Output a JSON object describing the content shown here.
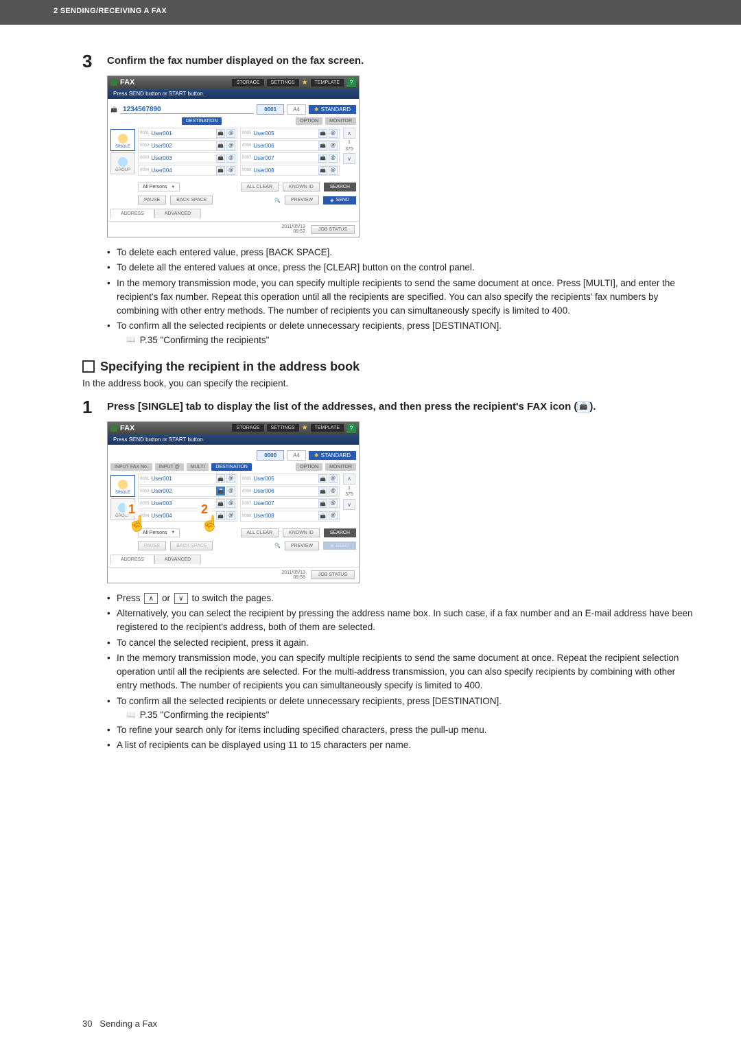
{
  "header": {
    "chapter": "2 SENDING/RECEIVING A FAX"
  },
  "step3": {
    "num": "3",
    "title": "Confirm the fax number displayed on the fax screen."
  },
  "panel1": {
    "title": "FAX",
    "hdr": {
      "storage": "STORAGE",
      "settings": "SETTINGS",
      "template": "TEMPLATE",
      "help": "?"
    },
    "msg": "Press SEND button or START button.",
    "faxno": "1234567890",
    "count": "0001",
    "paper": "A4",
    "std": "STANDARD",
    "tabs": {
      "dest": "DESTINATION",
      "option": "OPTION",
      "monitor": "MONITOR"
    },
    "side": {
      "single": "SINGLE",
      "group": "GROUP"
    },
    "rows": [
      {
        "l": {
          "idx": "0001",
          "name": "User001"
        },
        "r": {
          "idx": "0005",
          "name": "User005"
        }
      },
      {
        "l": {
          "idx": "0002",
          "name": "User002"
        },
        "r": {
          "idx": "0006",
          "name": "User006"
        }
      },
      {
        "l": {
          "idx": "0003",
          "name": "User003"
        },
        "r": {
          "idx": "0007",
          "name": "User007"
        }
      },
      {
        "l": {
          "idx": "0004",
          "name": "User004"
        },
        "r": {
          "idx": "0008",
          "name": "User008"
        }
      }
    ],
    "page": {
      "cur": "1",
      "total": "375"
    },
    "filter": "All Persons",
    "meta": {
      "allclear": "ALL CLEAR",
      "knownid": "KNOWN ID",
      "search": "SEARCH"
    },
    "act": {
      "pause": "PAUSE",
      "back": "BACK SPACE",
      "preview": "PREVIEW",
      "send": "SEND"
    },
    "bottabs": {
      "addr": "ADDRESS",
      "adv": "ADVANCED"
    },
    "status": {
      "time": "2011/05/13\n08:52",
      "job": "JOB STATUS"
    }
  },
  "bullets3": [
    "To delete each entered value, press [BACK SPACE].",
    "To delete all the entered values at once, press the [CLEAR] button on the control panel.",
    "In the memory transmission mode, you can specify multiple recipients to send the same document at once. Press [MULTI], and enter the recipient's fax number. Repeat this operation until all the recipients are specified. You can also specify the recipients' fax numbers by combining with other entry methods. The number of recipients you can simultaneously specify is limited to 400.",
    "To confirm all the selected recipients or delete unnecessary recipients, press [DESTINATION]."
  ],
  "ref3": "P.35 \"Confirming the recipients\"",
  "section2_title": "Specifying the recipient in the address book",
  "section2_intro": "In the address book, you can specify the recipient.",
  "step1": {
    "num": "1",
    "title_a": "Press [SINGLE] tab to display the list of the addresses, and then press the recipient's FAX icon (",
    "title_b": ")."
  },
  "panel2": {
    "count": "0000",
    "tabs": {
      "inputfax": "INPUT FAX No.",
      "inputat": "INPUT @",
      "multi": "MULTI",
      "dest": "DESTINATION",
      "option": "OPTION",
      "monitor": "MONITOR"
    },
    "status_time": "2011/05/13\n08:58"
  },
  "callouts": {
    "one": "1",
    "two": "2"
  },
  "bullets1": {
    "b0a": "Press ",
    "b0b": " or ",
    "b0c": " to switch the pages.",
    "b1": "Alternatively, you can select the recipient by pressing the address name box. In such case, if a fax number and an E-mail address have been registered to the recipient's address, both of them are selected.",
    "b2": "To cancel the selected recipient, press it again.",
    "b3": "In the memory transmission mode, you can specify multiple recipients to send the same document at once. Repeat the recipient selection operation until all the recipients are selected. For the multi-address transmission, you can also specify recipients by combining with other entry methods. The number of recipients you can simultaneously specify is limited to 400.",
    "b4": "To confirm all the selected recipients or delete unnecessary recipients, press [DESTINATION].",
    "b5": "To refine your search only for items including specified characters, press the pull-up menu.",
    "b6": "A list of recipients can be displayed using 11 to 15 characters per name."
  },
  "ref1": "P.35 \"Confirming the recipients\"",
  "footer": {
    "pagenum": "30",
    "section": "Sending a Fax"
  }
}
